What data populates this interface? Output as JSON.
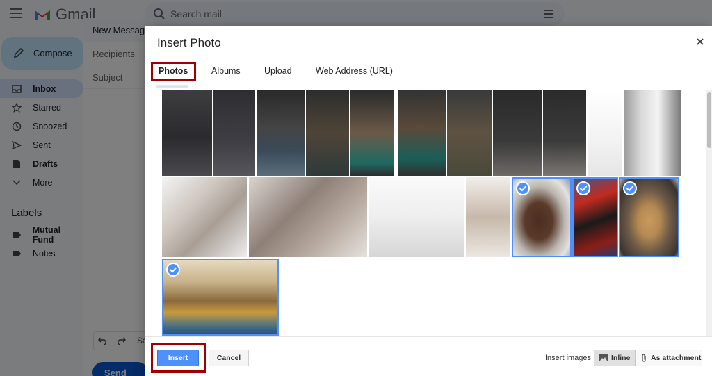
{
  "gmail": {
    "app_name": "Gmail",
    "search_placeholder": "Search mail",
    "compose_label": "Compose",
    "nav": [
      {
        "label": "Inbox",
        "icon": "inbox-icon"
      },
      {
        "label": "Starred",
        "icon": "star-icon"
      },
      {
        "label": "Snoozed",
        "icon": "clock-icon"
      },
      {
        "label": "Sent",
        "icon": "send-icon"
      },
      {
        "label": "Drafts",
        "icon": "file-icon"
      },
      {
        "label": "More",
        "icon": "chevron-down-icon"
      }
    ],
    "labels_title": "Labels",
    "labels": [
      {
        "label": "Mutual Fund",
        "icon": "label-icon"
      },
      {
        "label": "Notes",
        "icon": "label-icon"
      }
    ]
  },
  "compose": {
    "title": "New Message",
    "recipients_placeholder": "Recipients",
    "subject_placeholder": "Subject",
    "toolbar_text": "Sa",
    "send_label": "Send"
  },
  "dialog": {
    "title": "Insert Photo",
    "tabs": [
      "Photos",
      "Albums",
      "Upload",
      "Web Address (URL)"
    ],
    "active_tab": "Photos",
    "insert_label": "Insert",
    "cancel_label": "Cancel",
    "insert_images_label": "Insert images",
    "inline_label": "Inline",
    "attachment_label": "As attachment",
    "selected_count": 4
  },
  "colors": {
    "accent": "#4d90fe",
    "highlight": "#a00000",
    "compose_button": "#c2e7ff"
  }
}
